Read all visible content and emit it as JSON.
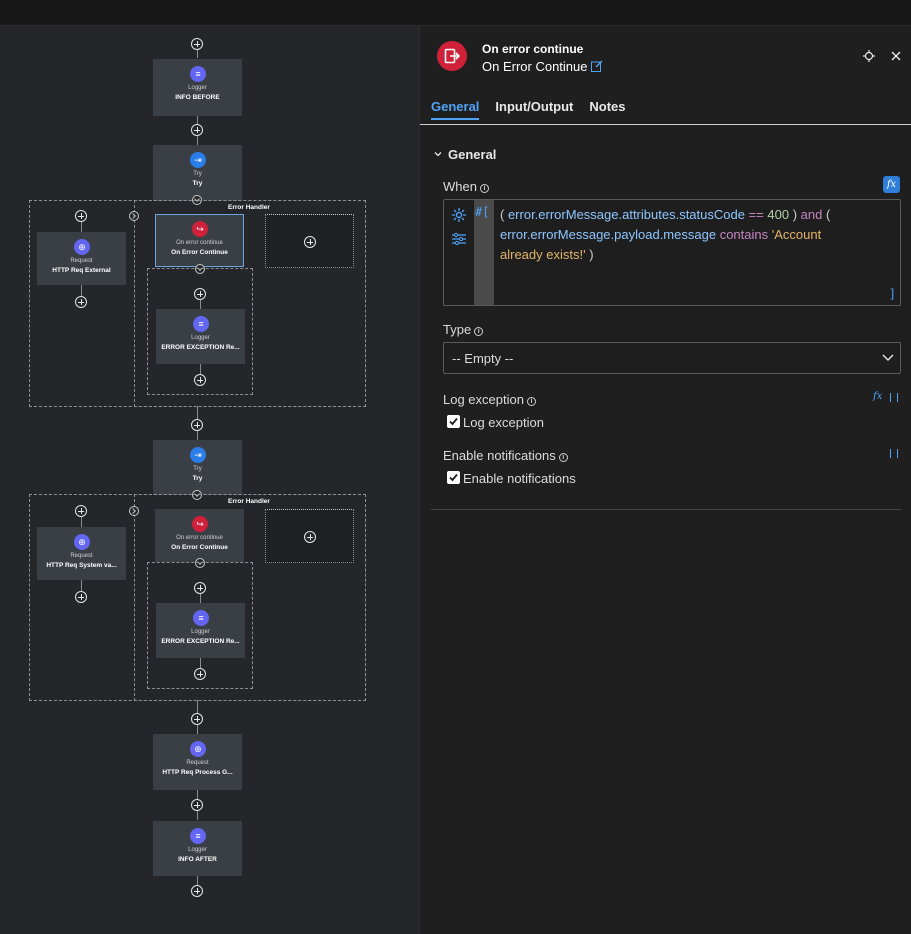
{
  "flow": {
    "nodes": [
      {
        "id": "logger-info-before",
        "type_label": "Logger",
        "name": "INFO BEFORE",
        "icon": "logger-icon"
      },
      {
        "id": "try-1",
        "type_label": "Try",
        "name": "Try",
        "icon": "try-icon"
      },
      {
        "id": "request-external",
        "type_label": "Request",
        "name": "HTTP Req External",
        "icon": "globe-icon"
      },
      {
        "id": "on-error-1",
        "type_label": "On error continue",
        "name": "On Error Continue",
        "icon": "error-continue-icon"
      },
      {
        "id": "logger-error-1",
        "type_label": "Logger",
        "name": "ERROR EXCEPTION Re...",
        "icon": "logger-icon"
      },
      {
        "id": "try-2",
        "type_label": "Try",
        "name": "Try",
        "icon": "try-icon"
      },
      {
        "id": "request-system",
        "type_label": "Request",
        "name": "HTTP Req System va...",
        "icon": "globe-icon"
      },
      {
        "id": "on-error-2",
        "type_label": "On error continue",
        "name": "On Error Continue",
        "icon": "error-continue-icon"
      },
      {
        "id": "logger-error-2",
        "type_label": "Logger",
        "name": "ERROR EXCEPTION Re...",
        "icon": "logger-icon"
      },
      {
        "id": "request-process",
        "type_label": "Request",
        "name": "HTTP Req Process G...",
        "icon": "globe-icon"
      },
      {
        "id": "logger-info-after",
        "type_label": "Logger",
        "name": "INFO AFTER",
        "icon": "logger-icon"
      }
    ],
    "error_handler_label": "Error Handler"
  },
  "panel": {
    "title": "On error continue",
    "subtitle": "On Error Continue",
    "tabs": [
      {
        "label": "General",
        "active": true
      },
      {
        "label": "Input/Output",
        "active": false
      },
      {
        "label": "Notes",
        "active": false
      }
    ],
    "section_title": "General",
    "when": {
      "label": "When",
      "fx_label": "fx",
      "prefix": "#[",
      "suffix": "]",
      "expression": "( error.errorMessage.attributes.statusCode == 400 ) and ( error.errorMessage.payload.message contains 'Account already exists!' )"
    },
    "type": {
      "label": "Type",
      "value": "-- Empty --"
    },
    "log_exception": {
      "label": "Log exception",
      "checkbox_label": "Log exception",
      "checked": true,
      "fx_label": "fx"
    },
    "enable_notifications": {
      "label": "Enable notifications",
      "checkbox_label": "Enable notifications",
      "checked": true
    }
  },
  "colors": {
    "accent": "#4fa3f7",
    "error_icon": "#d0213a",
    "logger_icon": "#6366f1",
    "try_icon": "#2b7de9"
  }
}
